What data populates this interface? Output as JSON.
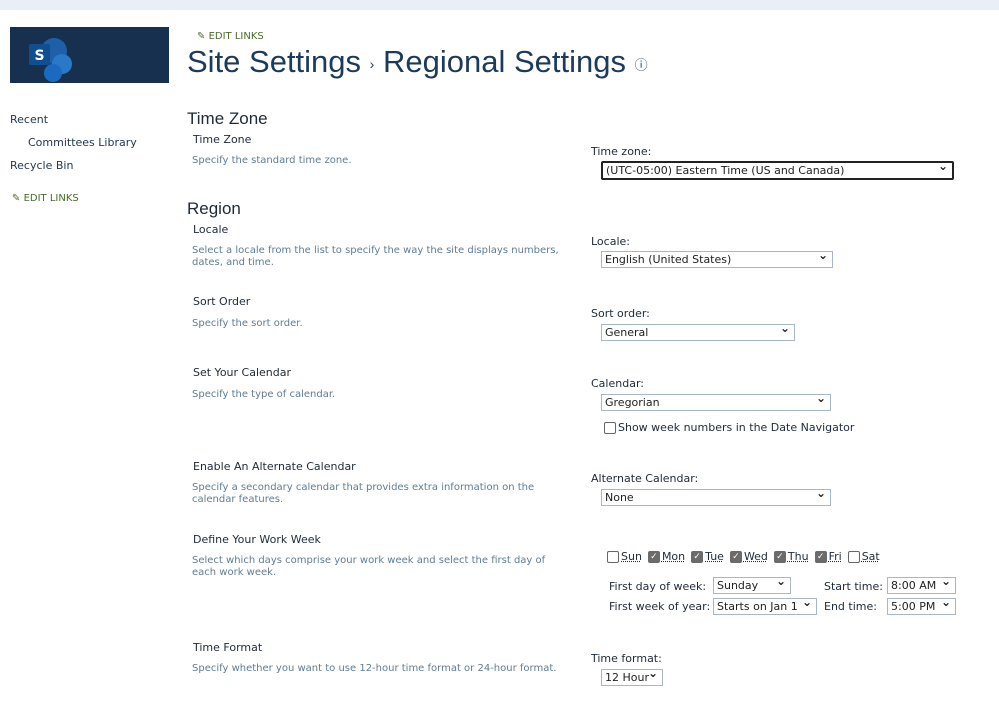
{
  "nav": {
    "edit_links": "EDIT LINKS",
    "items": [
      {
        "label": "Recent"
      },
      {
        "label": "Committees Library"
      },
      {
        "label": "Recycle Bin"
      }
    ],
    "edit_links_bottom": "EDIT LINKS"
  },
  "logo": {
    "letter": "S",
    "color": "#17304f"
  },
  "breadcrumb": {
    "parent": "Site Settings",
    "separator": "›",
    "current": "Regional Settings"
  },
  "sections": {
    "time_zone_heading": "Time Zone",
    "time_zone": {
      "label": "Time Zone",
      "desc": "Specify the standard time zone.",
      "field": "Time zone:",
      "value": "(UTC-05:00) Eastern Time (US and Canada)"
    },
    "region_heading": "Region",
    "locale": {
      "label": "Locale",
      "desc": "Select a locale from the list to specify the way the site displays numbers, dates, and time.",
      "field": "Locale:",
      "value": "English (United States)"
    },
    "sort": {
      "label": "Sort Order",
      "desc": "Specify the sort order.",
      "field": "Sort order:",
      "value": "General"
    },
    "calendar": {
      "label": "Set Your Calendar",
      "desc": "Specify the type of calendar.",
      "field": "Calendar:",
      "value": "Gregorian",
      "week_numbers": "Show week numbers in the Date Navigator",
      "week_numbers_checked": false
    },
    "alt_calendar": {
      "label": "Enable An Alternate Calendar",
      "desc": "Specify a secondary calendar that provides extra information on the calendar features.",
      "field": "Alternate Calendar:",
      "value": "None"
    },
    "work_week": {
      "label": "Define Your Work Week",
      "desc": "Select which days comprise your work week and select the first day of each work week.",
      "days": [
        {
          "label": "Sun",
          "checked": false
        },
        {
          "label": "Mon",
          "checked": true
        },
        {
          "label": "Tue",
          "checked": true
        },
        {
          "label": "Wed",
          "checked": true
        },
        {
          "label": "Thu",
          "checked": true
        },
        {
          "label": "Fri",
          "checked": true
        },
        {
          "label": "Sat",
          "checked": false
        }
      ],
      "first_day_label": "First day of week:",
      "first_day": "Sunday",
      "first_week_label": "First week of year:",
      "first_week": "Starts on Jan 1",
      "start_label": "Start time:",
      "start": "8:00 AM",
      "end_label": "End time:",
      "end": "5:00 PM"
    },
    "time_format": {
      "label": "Time Format",
      "desc": "Specify whether you want to use 12-hour time format or 24-hour format.",
      "field": "Time format:",
      "value": "12 Hour"
    }
  }
}
